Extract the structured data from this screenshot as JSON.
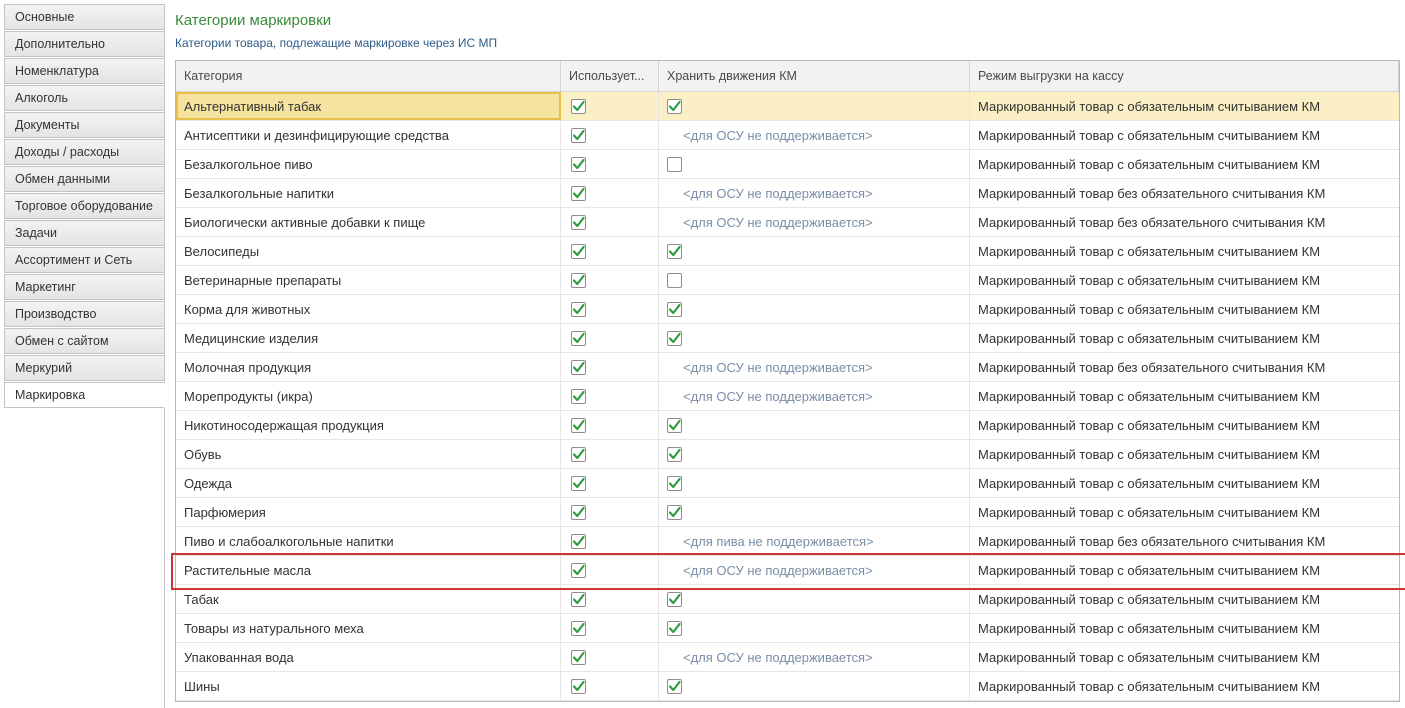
{
  "tabs": [
    {
      "label": "Основные",
      "active": false
    },
    {
      "label": "Дополнительно",
      "active": false
    },
    {
      "label": "Номенклатура",
      "active": false
    },
    {
      "label": "Алкоголь",
      "active": false
    },
    {
      "label": "Документы",
      "active": false
    },
    {
      "label": "Доходы / расходы",
      "active": false
    },
    {
      "label": "Обмен данными",
      "active": false
    },
    {
      "label": "Торговое оборудование",
      "active": false
    },
    {
      "label": "Задачи",
      "active": false
    },
    {
      "label": "Ассортимент и Сеть",
      "active": false
    },
    {
      "label": "Маркетинг",
      "active": false
    },
    {
      "label": "Производство",
      "active": false
    },
    {
      "label": "Обмен с сайтом",
      "active": false
    },
    {
      "label": "Меркурий",
      "active": false
    },
    {
      "label": "Маркировка",
      "active": true
    }
  ],
  "header": {
    "title": "Категории маркировки",
    "subtitle": "Категории товара, подлежащие маркировке через ИС МП"
  },
  "table": {
    "columns": [
      "Категория",
      "Использует...",
      "Хранить движения КМ",
      "Режим выгрузки на кассу"
    ],
    "rows": [
      {
        "category": "Альтернативный табак",
        "used": true,
        "store": "checked",
        "note": "",
        "mode": "Маркированный товар с обязательным считыванием КМ",
        "selected": true
      },
      {
        "category": "Антисептики и дезинфицирующие средства",
        "used": true,
        "store": "note",
        "note": "<для ОСУ не поддерживается>",
        "mode": "Маркированный товар с обязательным считыванием КМ"
      },
      {
        "category": "Безалкогольное пиво",
        "used": true,
        "store": "unchecked",
        "note": "",
        "mode": "Маркированный товар с обязательным считыванием КМ"
      },
      {
        "category": "Безалкогольные напитки",
        "used": true,
        "store": "note",
        "note": "<для ОСУ не поддерживается>",
        "mode": "Маркированный товар без обязательного считывания КМ"
      },
      {
        "category": "Биологически активные добавки к пище",
        "used": true,
        "store": "note",
        "note": "<для ОСУ не поддерживается>",
        "mode": "Маркированный товар без обязательного считывания КМ"
      },
      {
        "category": "Велосипеды",
        "used": true,
        "store": "checked",
        "note": "",
        "mode": "Маркированный товар с обязательным считыванием КМ"
      },
      {
        "category": "Ветеринарные препараты",
        "used": true,
        "store": "unchecked",
        "note": "",
        "mode": "Маркированный товар с обязательным считыванием КМ"
      },
      {
        "category": "Корма для животных",
        "used": true,
        "store": "checked",
        "note": "",
        "mode": "Маркированный товар с обязательным считыванием КМ"
      },
      {
        "category": "Медицинские изделия",
        "used": true,
        "store": "checked",
        "note": "",
        "mode": "Маркированный товар с обязательным считыванием КМ"
      },
      {
        "category": "Молочная продукция",
        "used": true,
        "store": "note",
        "note": "<для ОСУ не поддерживается>",
        "mode": "Маркированный товар без обязательного считывания КМ"
      },
      {
        "category": "Морепродукты (икра)",
        "used": true,
        "store": "note",
        "note": "<для ОСУ не поддерживается>",
        "mode": "Маркированный товар с обязательным считыванием КМ"
      },
      {
        "category": "Никотиносодержащая продукция",
        "used": true,
        "store": "checked",
        "note": "",
        "mode": "Маркированный товар с обязательным считыванием КМ"
      },
      {
        "category": "Обувь",
        "used": true,
        "store": "checked",
        "note": "",
        "mode": "Маркированный товар с обязательным считыванием КМ"
      },
      {
        "category": "Одежда",
        "used": true,
        "store": "checked",
        "note": "",
        "mode": "Маркированный товар с обязательным считыванием КМ"
      },
      {
        "category": "Парфюмерия",
        "used": true,
        "store": "checked",
        "note": "",
        "mode": "Маркированный товар с обязательным считыванием КМ"
      },
      {
        "category": "Пиво и слабоалкогольные напитки",
        "used": true,
        "store": "note",
        "note": "<для пива не поддерживается>",
        "mode": "Маркированный товар без обязательного считывания КМ"
      },
      {
        "category": "Растительные масла",
        "used": true,
        "store": "note",
        "note": "<для ОСУ не поддерживается>",
        "mode": "Маркированный товар с обязательным считыванием КМ"
      },
      {
        "category": "Табак",
        "used": true,
        "store": "checked",
        "note": "",
        "mode": "Маркированный товар с обязательным считыванием КМ"
      },
      {
        "category": "Товары из натурального меха",
        "used": true,
        "store": "checked",
        "note": "",
        "mode": "Маркированный товар с обязательным считыванием КМ"
      },
      {
        "category": "Упакованная вода",
        "used": true,
        "store": "note",
        "note": "<для ОСУ не поддерживается>",
        "mode": "Маркированный товар с обязательным считыванием КМ"
      },
      {
        "category": "Шины",
        "used": true,
        "store": "checked",
        "note": "",
        "mode": "Маркированный товар с обязательным считыванием КМ"
      }
    ]
  },
  "colors": {
    "title": "#3a8c3a",
    "subtitle": "#2e5c8a",
    "checkmark": "#2e9c3e",
    "selected_row": "#fbf0c5",
    "highlight_frame": "#cc3333"
  }
}
